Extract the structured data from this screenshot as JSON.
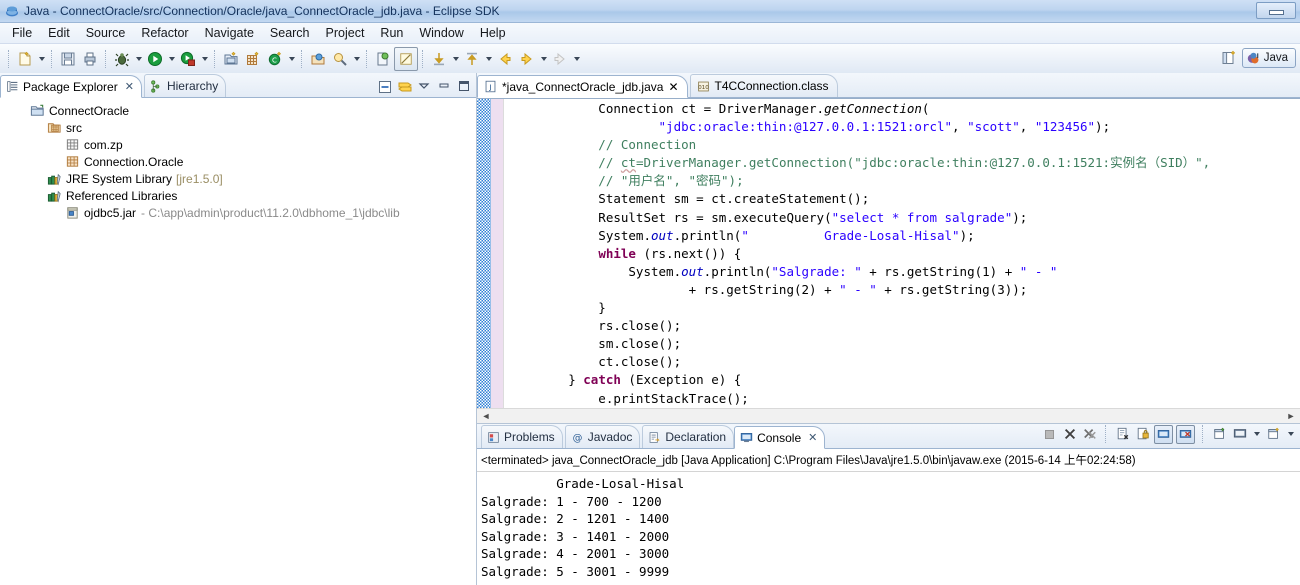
{
  "window": {
    "title": "Java - ConnectOracle/src/Connection/Oracle/java_ConnectOracle_jdb.java - Eclipse SDK",
    "app_icon": "eclipse-icon",
    "restore_button": "restore-window-button"
  },
  "menubar": {
    "items": [
      {
        "label": "File",
        "name": "menu-file"
      },
      {
        "label": "Edit",
        "name": "menu-edit"
      },
      {
        "label": "Source",
        "name": "menu-source"
      },
      {
        "label": "Refactor",
        "name": "menu-refactor"
      },
      {
        "label": "Navigate",
        "name": "menu-navigate"
      },
      {
        "label": "Search",
        "name": "menu-search"
      },
      {
        "label": "Project",
        "name": "menu-project"
      },
      {
        "label": "Run",
        "name": "menu-run"
      },
      {
        "label": "Window",
        "name": "menu-window"
      },
      {
        "label": "Help",
        "name": "menu-help"
      }
    ]
  },
  "toolbar": {
    "perspective_label": "Java",
    "perspective_icon": "java-perspective-icon",
    "open_perspective_icon": "open-perspective-icon",
    "buttons": [
      "new-icon",
      "save-icon",
      "print-icon",
      "debug-icon",
      "run-icon",
      "run-last-tool-icon",
      "new-java-project-icon",
      "new-package-icon",
      "new-class-icon",
      "open-type-icon",
      "search-icon",
      "toggle-mark-occurrences-icon",
      "skip-all-breakpoints-icon",
      "next-annotation-icon",
      "previous-annotation-icon",
      "back-icon",
      "forward-icon",
      "forward-disabled-icon"
    ]
  },
  "package_explorer": {
    "tabs": [
      {
        "label": "Package Explorer",
        "icon": "package-explorer-icon",
        "active": true,
        "closable": true
      },
      {
        "label": "Hierarchy",
        "icon": "hierarchy-icon",
        "active": false,
        "closable": false
      }
    ],
    "view_tools": [
      "collapse-all-icon",
      "link-with-editor-icon",
      "view-menu-icon",
      "minimize-icon",
      "maximize-icon"
    ],
    "tree": [
      {
        "label": "ConnectOracle",
        "icon": "java-project-icon",
        "indent": 0,
        "suffix": ""
      },
      {
        "label": "src",
        "icon": "source-folder-icon",
        "indent": 1,
        "suffix": ""
      },
      {
        "label": "com.zp",
        "icon": "package-icon",
        "indent": 2,
        "suffix": ""
      },
      {
        "label": "Connection.Oracle",
        "icon": "package-full-icon",
        "indent": 2,
        "suffix": ""
      },
      {
        "label": "JRE System Library",
        "icon": "library-icon",
        "indent": 1,
        "suffix": "[jre1.5.0]"
      },
      {
        "label": "Referenced Libraries",
        "icon": "library-icon",
        "indent": 1,
        "suffix": ""
      },
      {
        "label": "ojdbc5.jar",
        "icon": "jar-icon",
        "indent": 2,
        "suffix": "- C:\\app\\admin\\product\\11.2.0\\dbhome_1\\jdbc\\lib"
      }
    ]
  },
  "editor": {
    "tabs": [
      {
        "label": "*java_ConnectOracle_jdb.java",
        "icon": "java-file-icon",
        "active": true,
        "closable": true
      },
      {
        "label": "T4CConnection.class",
        "icon": "class-file-icon",
        "active": false,
        "closable": false
      }
    ],
    "scroll_left_arrow": "◄",
    "scroll_right_arrow": "►",
    "code_lines": [
      "            Connection ct = DriverManager.getConnection(",
      "                    \"jdbc:oracle:thin:@127.0.0.1:1521:orcl\", \"scott\", \"123456\");",
      "            // Connection",
      "            // ct=DriverManager.getConnection(\"jdbc:oracle:thin:@127.0.0.1:1521:实例名（SID）\",",
      "            // \"用户名\", \"密码\");",
      "            Statement sm = ct.createStatement();",
      "            ResultSet rs = sm.executeQuery(\"select * from salgrade\");",
      "            System.out.println(\"          Grade-Losal-Hisal\");",
      "            while (rs.next()) {",
      "                System.out.println(\"Salgrade: \" + rs.getString(1) + \" - \"",
      "                        + rs.getString(2) + \" - \" + rs.getString(3));",
      "            }",
      "            rs.close();",
      "            sm.close();",
      "            ct.close();",
      "        } catch (Exception e) {",
      "            e.printStackTrace();",
      "        }"
    ]
  },
  "console": {
    "tabs": [
      {
        "label": "Problems",
        "icon": "problems-icon",
        "active": false,
        "closable": false
      },
      {
        "label": "Javadoc",
        "icon": "javadoc-icon",
        "active": false,
        "closable": false
      },
      {
        "label": "Declaration",
        "icon": "declaration-icon",
        "active": false,
        "closable": false
      },
      {
        "label": "Console",
        "icon": "console-icon",
        "active": true,
        "closable": true
      }
    ],
    "tools": [
      "terminate-icon",
      "remove-launch-icon",
      "remove-all-terminated-icon",
      "clear-console-icon",
      "lock-scroll-icon",
      "pin-console-icon",
      "display-selected-console-icon",
      "open-console-icon",
      "minimize-console-icon",
      "console-view-menu-icon",
      "new-console-view-icon"
    ],
    "header": "<terminated> java_ConnectOracle_jdb [Java Application] C:\\Program Files\\Java\\jre1.5.0\\bin\\javaw.exe (2015-6-14 上午02:24:58)",
    "output_lines": [
      "          Grade-Losal-Hisal",
      "Salgrade: 1 - 700 - 1200",
      "Salgrade: 2 - 1201 - 1400",
      "Salgrade: 3 - 1401 - 2000",
      "Salgrade: 4 - 2001 - 3000",
      "Salgrade: 5 - 3001 - 9999"
    ]
  },
  "colors": {
    "keyword": "#7f0055",
    "string": "#2a00ff",
    "comment": "#3f7f5f",
    "field": "#0000c0",
    "titlebar": "#bdd4ef"
  }
}
